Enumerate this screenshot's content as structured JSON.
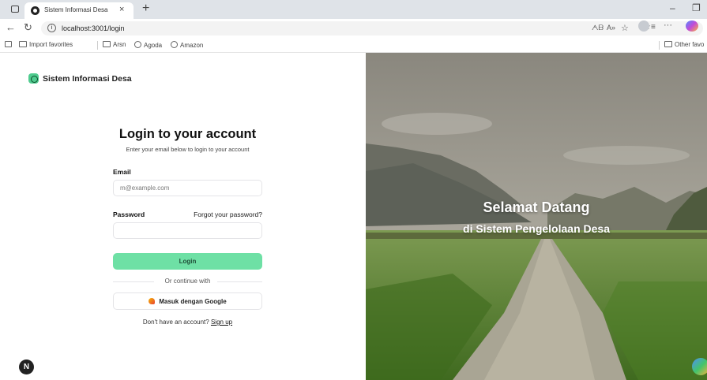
{
  "browser": {
    "tab_title": "Sistem Informasi Desa",
    "tab_close": "×",
    "new_tab": "+",
    "minimize": "–",
    "restore": "❐",
    "url": "localhost:3001/login",
    "info_glyph": "i",
    "toolbar_icons": [
      "reader-mode-icon",
      "read-aloud-icon",
      "favorite-star-icon",
      "favorites-icon",
      "profile-icon",
      "more-icon",
      "copilot-icon"
    ],
    "bookmarks": [
      "Import favorites",
      "Arsn",
      "Agoda",
      "Amazon"
    ],
    "other_favorites": "Other favo"
  },
  "login": {
    "brand": "Sistem Informasi Desa",
    "title": "Login to your account",
    "subtitle": "Enter your email below to login to your account",
    "email_label": "Email",
    "email_placeholder": "m@example.com",
    "password_label": "Password",
    "forgot_link": "Forgot your password?",
    "login_button": "Login",
    "divider_text": "Or continue with",
    "google_button": "Masuk dengan Google",
    "signup_prompt": "Don't have an account?",
    "signup_link": "Sign up",
    "dev_badge": "N"
  },
  "hero": {
    "title": "Selamat Datang",
    "subtitle": "di Sistem Pengelolaan Desa"
  },
  "colors": {
    "accent": "#6ee0a5",
    "brand_logo": "#4fcc8f"
  }
}
